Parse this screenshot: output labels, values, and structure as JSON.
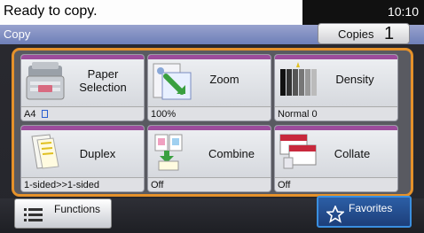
{
  "status": {
    "message": "Ready to copy.",
    "time": "10:10"
  },
  "screen": {
    "title": "Copy"
  },
  "copies": {
    "label": "Copies",
    "count": "1"
  },
  "tiles": [
    {
      "label": "Paper Selection",
      "value": "A4",
      "icon": "paper-tray-icon"
    },
    {
      "label": "Zoom",
      "value": "100%",
      "icon": "zoom-icon"
    },
    {
      "label": "Density",
      "value": "Normal 0",
      "icon": "density-icon"
    },
    {
      "label": "Duplex",
      "value": "1-sided>>1-sided",
      "icon": "duplex-icon"
    },
    {
      "label": "Combine",
      "value": "Off",
      "icon": "combine-icon"
    },
    {
      "label": "Collate",
      "value": "Off",
      "icon": "collate-icon"
    }
  ],
  "bottom": {
    "functions_label": "Functions",
    "favorites_label": "Favorites"
  },
  "colors": {
    "accent_orange": "#e5912a",
    "tile_stripe": "#9c4c9c",
    "title_bar": "#7f8dc0",
    "favorites_blue": "#2c5fa6"
  }
}
